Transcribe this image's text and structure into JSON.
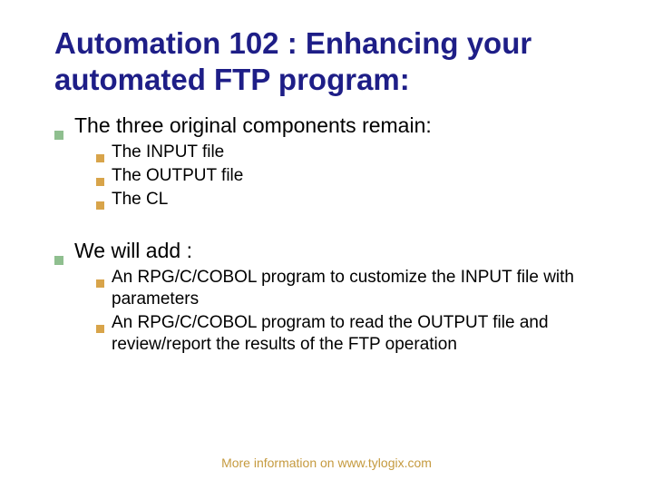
{
  "title_line1": "Automation 102 : Enhancing your",
  "title_line2": "automated FTP program:",
  "sections": [
    {
      "text": "The three original components remain:",
      "items": [
        "The INPUT file",
        "The OUTPUT file",
        "The CL"
      ]
    },
    {
      "text": "We will add :",
      "items": [
        "An RPG/C/COBOL program to customize the INPUT file with parameters",
        "An RPG/C/COBOL program to read the OUTPUT file and review/report the results of the FTP operation"
      ]
    }
  ],
  "footer": "More information on www.tylogix.com"
}
